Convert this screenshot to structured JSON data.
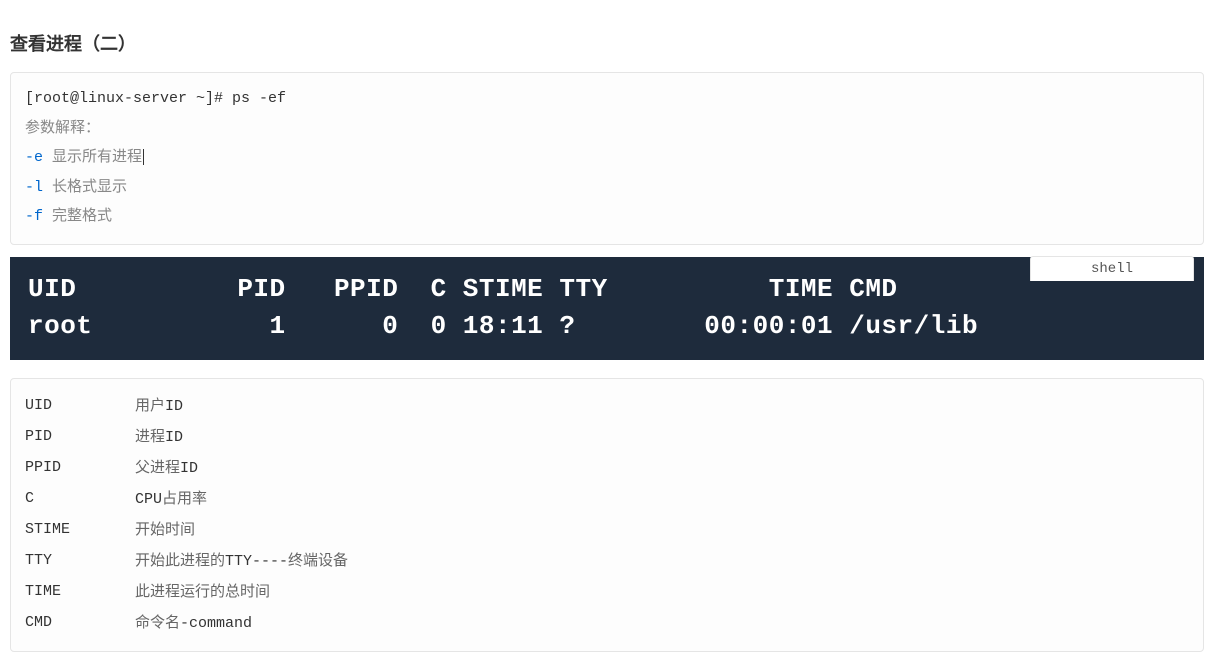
{
  "title": "查看进程（二）",
  "codeBlock": {
    "prompt": "[root@linux-server ~]# ps -ef",
    "paramHeader": "参数解释：",
    "params": [
      {
        "flag": "-e",
        "desc": "显示所有进程"
      },
      {
        "flag": "-l",
        "desc": "长格式显示"
      },
      {
        "flag": "-f",
        "desc": "完整格式"
      }
    ]
  },
  "langLabel": "shell",
  "terminal": {
    "header": "UID          PID   PPID  C STIME TTY          TIME CMD",
    "row": "root           1      0  0 18:11 ?        00:00:01 /usr/lib"
  },
  "fields": [
    {
      "key": "UID",
      "val_pre": "用户",
      "val_mono": "ID",
      "val_post": ""
    },
    {
      "key": "PID",
      "val_pre": "进程",
      "val_mono": "ID",
      "val_post": ""
    },
    {
      "key": "PPID",
      "val_pre": "父进程",
      "val_mono": "ID",
      "val_post": ""
    },
    {
      "key": "C",
      "val_pre": "",
      "val_mono": "CPU",
      "val_post": "占用率"
    },
    {
      "key": "STIME",
      "val_pre": "开始时间",
      "val_mono": "",
      "val_post": ""
    },
    {
      "key": "TTY",
      "val_pre": "开始此进程的",
      "val_mono": "TTY----",
      "val_post": "终端设备"
    },
    {
      "key": "TIME",
      "val_pre": "此进程运行的总时间",
      "val_mono": "",
      "val_post": ""
    },
    {
      "key": "CMD",
      "val_pre": "命令名",
      "val_mono": "-command",
      "val_post": ""
    }
  ]
}
